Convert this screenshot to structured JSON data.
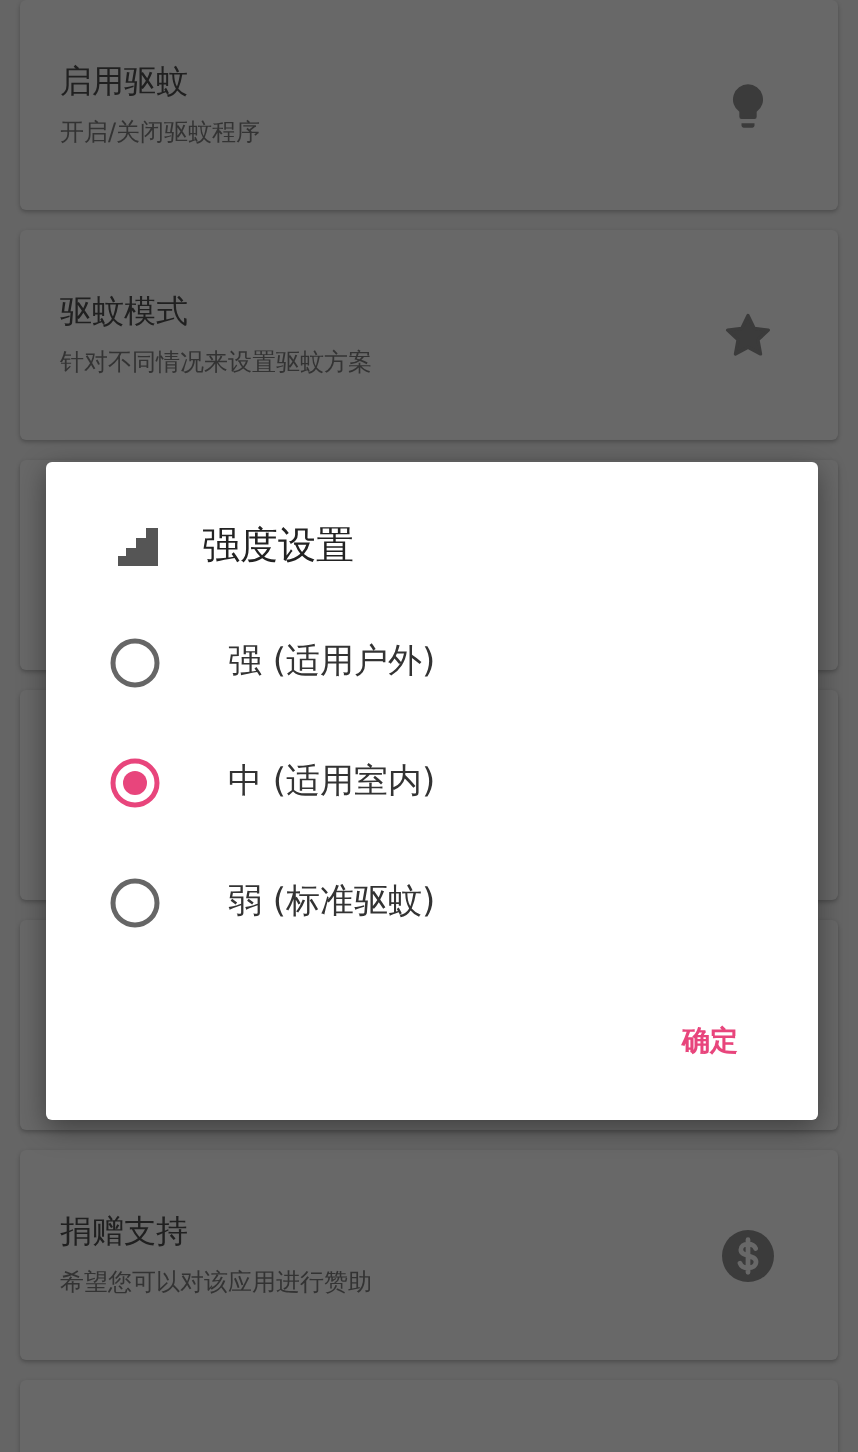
{
  "settings": [
    {
      "title": "启用驱蚊",
      "subtitle": "开启/关闭驱蚊程序",
      "kind": "bulb"
    },
    {
      "title": "驱蚊模式",
      "subtitle": "针对不同情况来设置驱蚊方案",
      "kind": "star"
    },
    {
      "kind": "hidden"
    },
    {
      "kind": "hidden"
    },
    {
      "kind": "hidden"
    },
    {
      "title": "捐赠支持",
      "subtitle": "希望您可以对该应用进行赞助",
      "kind": "dollar"
    },
    {
      "kind": "hidden"
    }
  ],
  "dialog": {
    "title": "强度设置",
    "options": [
      {
        "label": "强 (适用户外)",
        "selected": false
      },
      {
        "label": "中 (适用室内)",
        "selected": true
      },
      {
        "label": "弱 (标准驱蚊)",
        "selected": false
      }
    ],
    "button": "确定"
  }
}
